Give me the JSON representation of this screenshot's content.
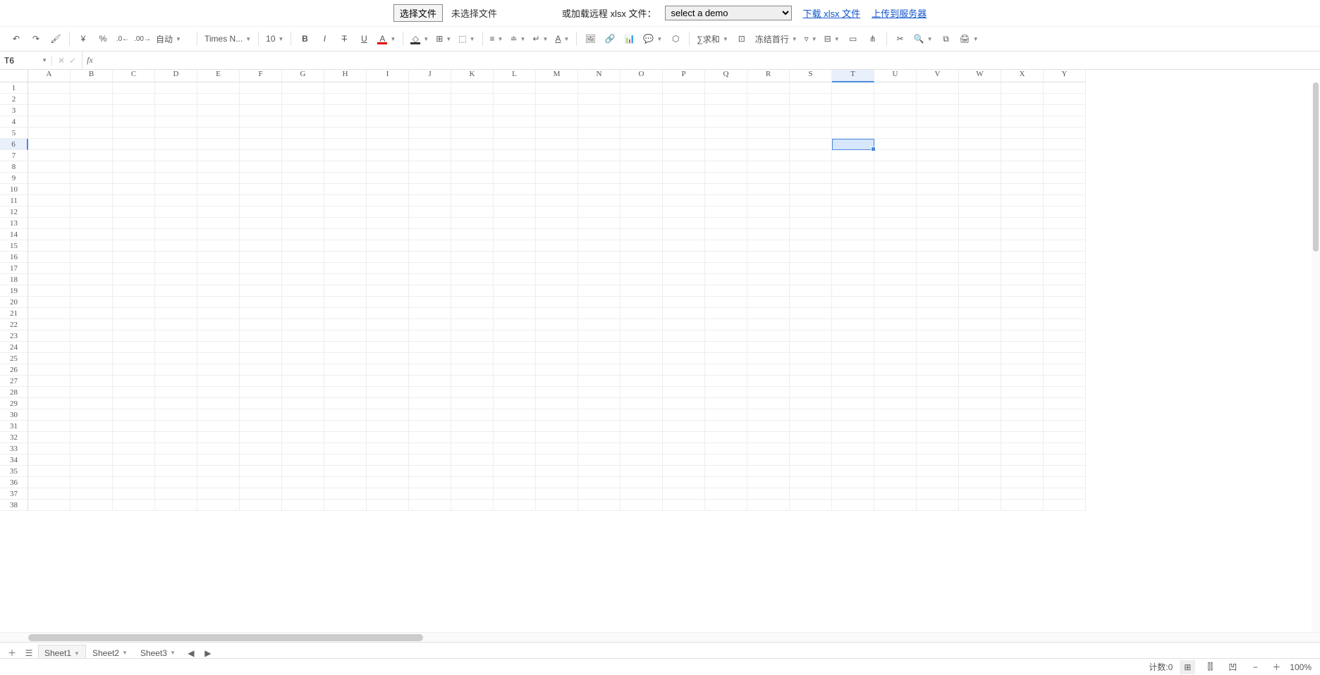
{
  "topbar": {
    "choose_file": "选择文件",
    "no_file": "未选择文件",
    "remote_label": "或加载远程 xlsx 文件：",
    "select_placeholder": "select a demo",
    "download_link": "下载 xlsx 文件",
    "upload_link": "上传到服务器"
  },
  "toolbar": {
    "format_auto": "自动",
    "font_name": "Times N...",
    "font_size": "10",
    "sum_label": "∑求和",
    "freeze_label": "冻结首行"
  },
  "namebox": {
    "cell_ref": "T6",
    "fx": "fx"
  },
  "grid": {
    "columns": [
      "A",
      "B",
      "C",
      "D",
      "E",
      "F",
      "G",
      "H",
      "I",
      "J",
      "K",
      "L",
      "M",
      "N",
      "O",
      "P",
      "Q",
      "R",
      "S",
      "T",
      "U",
      "V",
      "W",
      "X",
      "Y"
    ],
    "rows": 38,
    "selected_col": "T",
    "selected_row": 6
  },
  "sheets": {
    "tabs": [
      "Sheet1",
      "Sheet2",
      "Sheet3"
    ],
    "active": 0
  },
  "status": {
    "count_label": "计数:0",
    "zoom": "100%"
  }
}
